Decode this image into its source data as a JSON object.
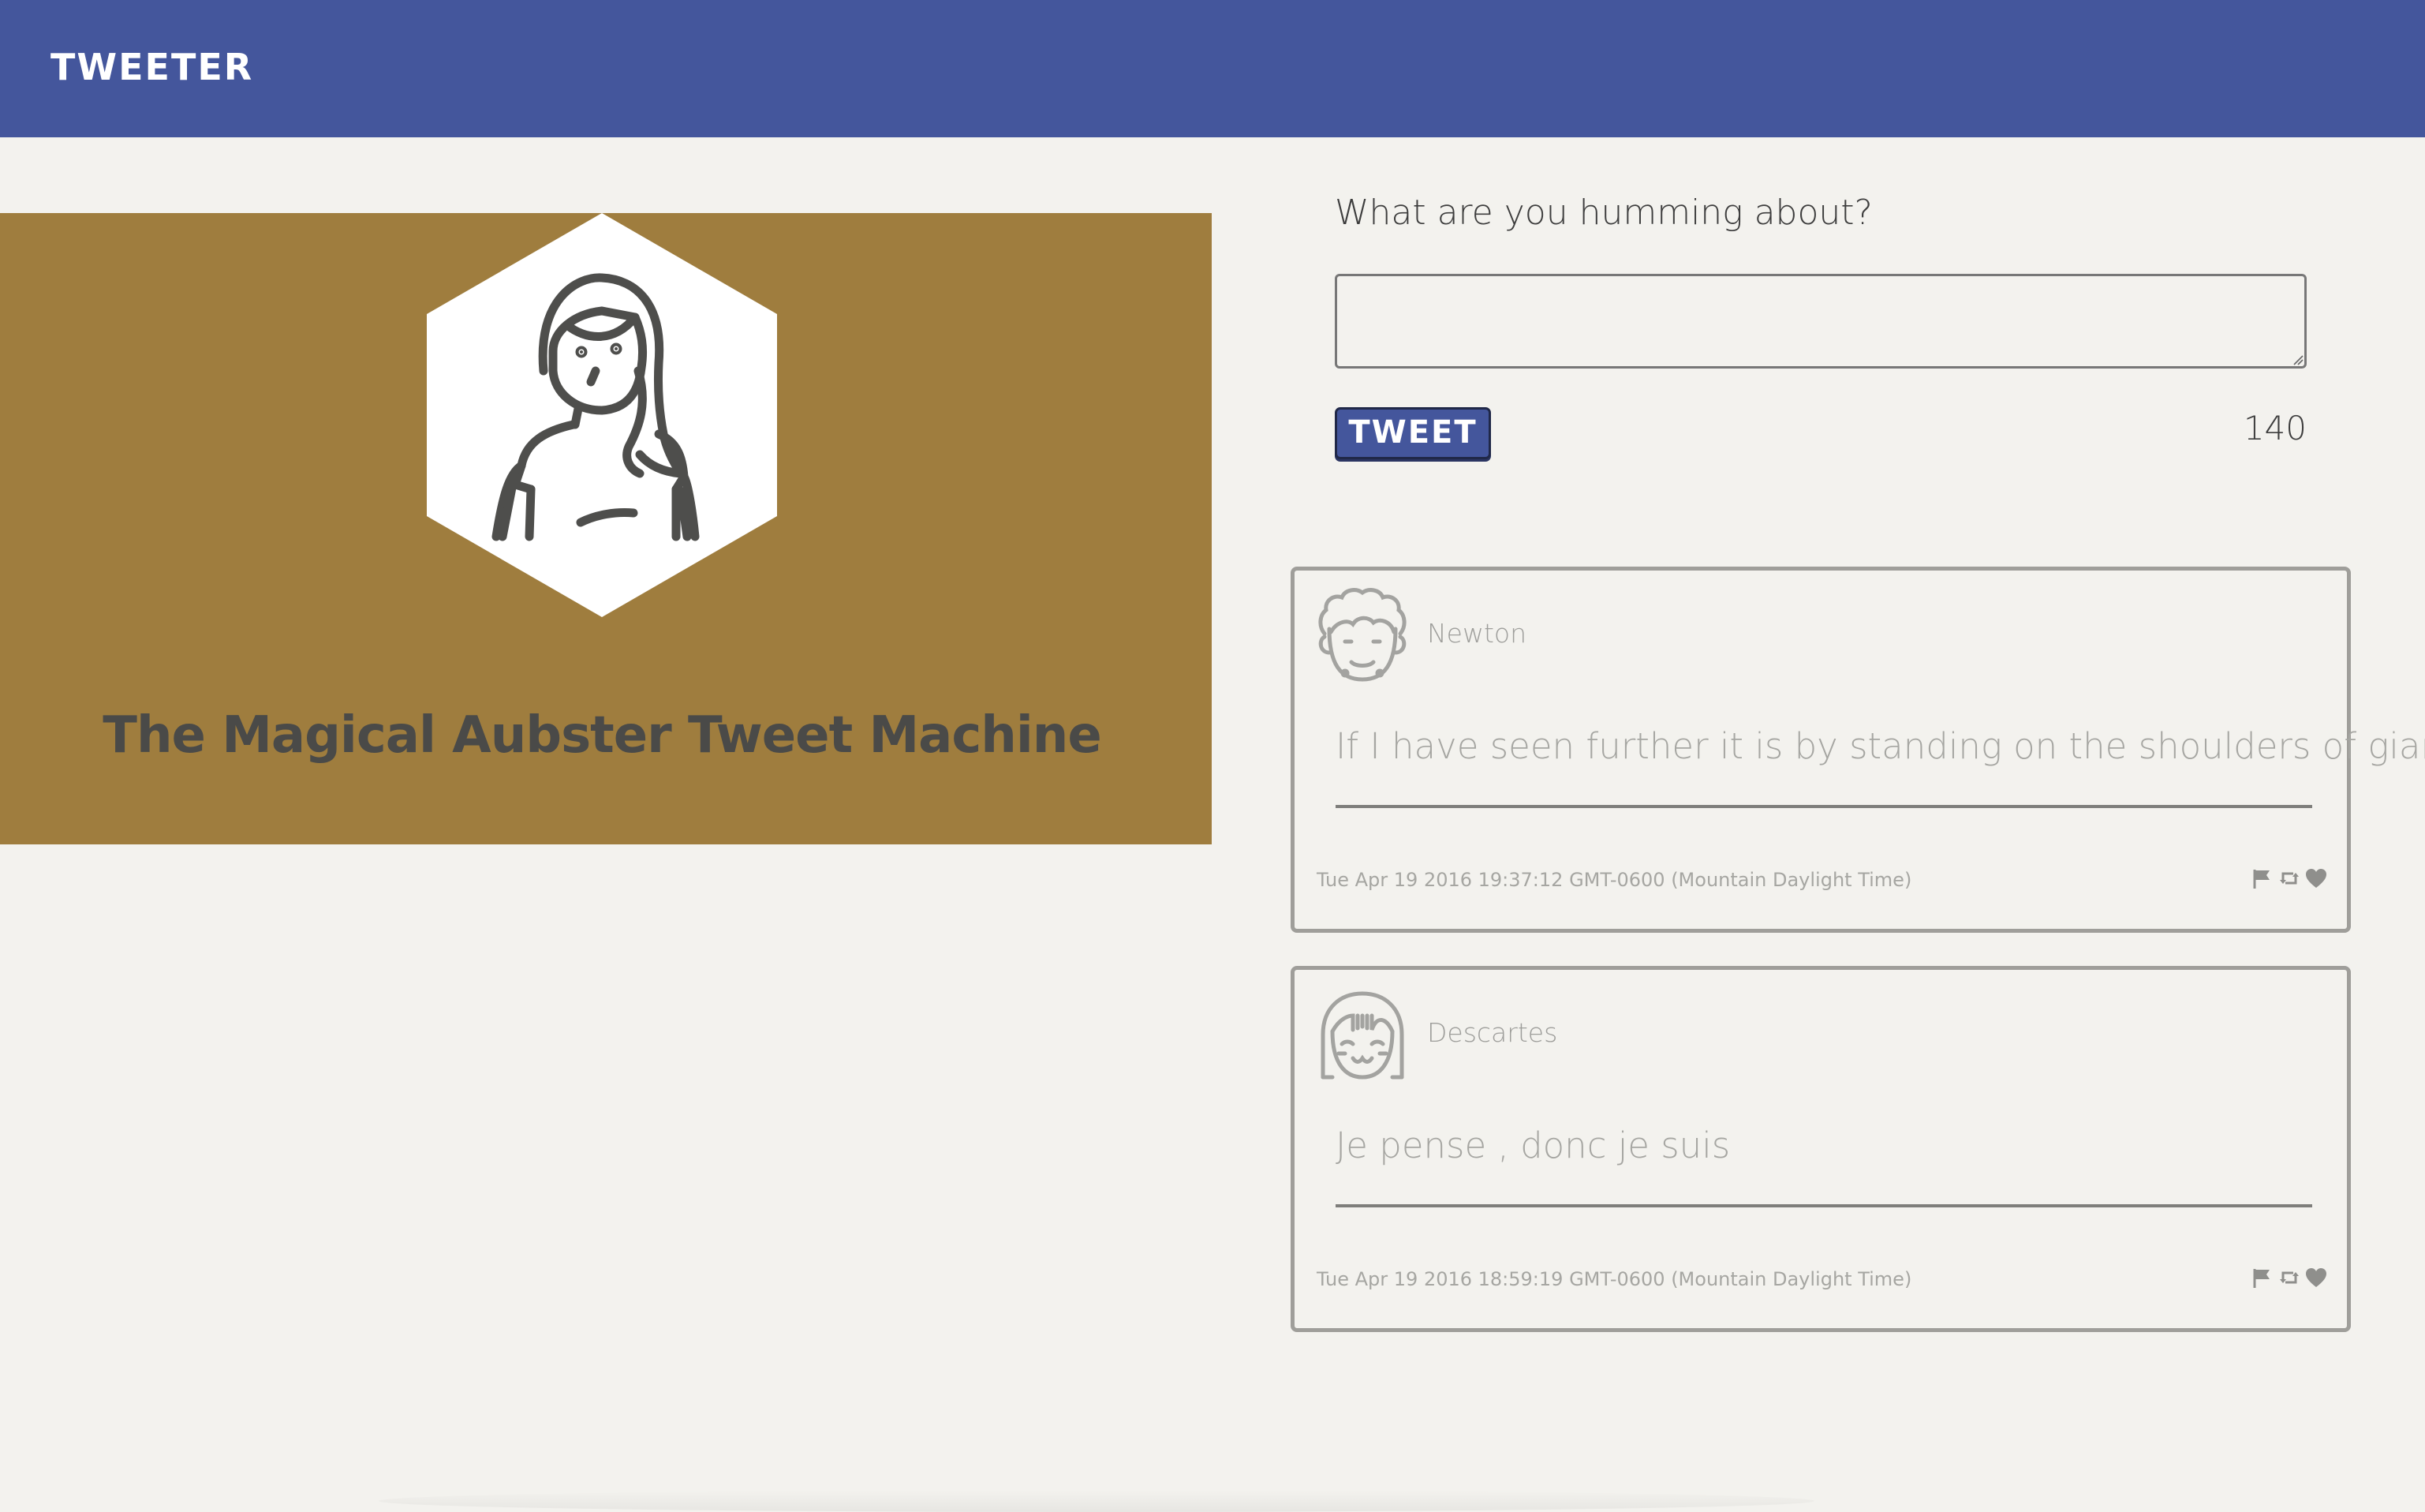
{
  "header": {
    "brand": "TWEETER",
    "background_color": "#44569c"
  },
  "profile": {
    "name": "The Magical Aubster Tweet Machine",
    "avatar_icon": "woman-avatar-icon",
    "background_color": "#9f7d3e"
  },
  "compose": {
    "prompt": "What are you humming about?",
    "input_value": "",
    "button_label": "TWEET",
    "char_counter": "140"
  },
  "tweets": [
    {
      "author": "Newton",
      "avatar_icon": "curly-hair-face-icon",
      "text": "If I have seen further it is by standing on the shoulders of giants",
      "timestamp": "Tue Apr 19 2016 19:37:12 GMT-0600 (Mountain Daylight Time)",
      "actions": [
        "flag-icon",
        "retweet-icon",
        "heart-icon"
      ]
    },
    {
      "author": "Descartes",
      "avatar_icon": "bob-hair-face-icon",
      "text": "Je pense , donc je suis",
      "timestamp": "Tue Apr 19 2016 18:59:19 GMT-0600 (Mountain Daylight Time)",
      "actions": [
        "flag-icon",
        "retweet-icon",
        "heart-icon"
      ]
    }
  ]
}
